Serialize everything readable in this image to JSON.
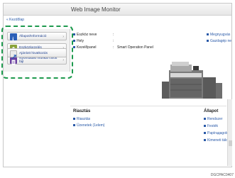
{
  "header": {
    "title": "Web Image Monitor"
  },
  "breadcrumb": {
    "home": "« Kezdőlap"
  },
  "sidebar": {
    "items": [
      {
        "label": "Állapot/Információ",
        "icon": "info-icon",
        "color": "#2b5fb8"
      },
      {
        "label": "Eszközkezelés",
        "icon": "device-management-icon",
        "color": "#8aa33b"
      },
      {
        "label": "Nyomtatási munka/Tárolt fájl",
        "icon": "print-job-icon",
        "color": "#6a3fa0"
      },
      {
        "label": "Ajánlott hivatkozás",
        "icon": "link-icon",
        "color": "#2b5fb8"
      }
    ]
  },
  "device": {
    "name_label": "Eszköz neve",
    "host_label": "Hely",
    "panel_label": "Kezelőpanel",
    "panel_value": "Smart Operation Panel",
    "sep": ":"
  },
  "quicklinks": [
    "Megnyugvás",
    "Gazdagép ne"
  ],
  "lower": {
    "left_header": "Riasztás",
    "left_links": [
      "Riasztás",
      "Üzenetek (1elem)"
    ],
    "right_header": "Állapot",
    "right_links": [
      "Rendszer",
      "Festék",
      "Papírадagoló",
      "Kimeneti tálca"
    ]
  },
  "code": "DGCPAC0407"
}
